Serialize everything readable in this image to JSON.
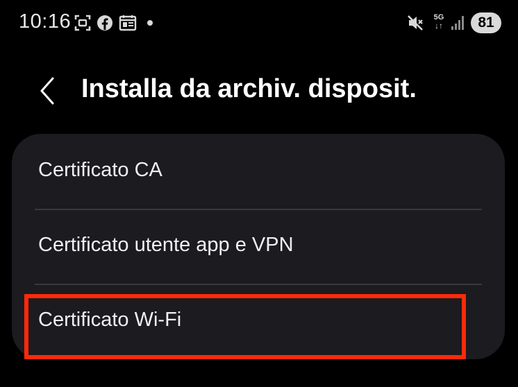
{
  "status_bar": {
    "time": "10:16",
    "network_type": "5G",
    "battery_level": "81",
    "icons": [
      "screenshot-icon",
      "facebook-icon",
      "calendar-news-icon",
      "notification-dot-icon",
      "mute-icon",
      "network-5g-icon",
      "signal-icon",
      "battery-icon"
    ]
  },
  "header": {
    "title": "Installa da archiv. disposit.",
    "back_icon": "chevron-left-icon"
  },
  "list": {
    "items": [
      {
        "label": "Certificato CA"
      },
      {
        "label": "Certificato utente app e VPN"
      },
      {
        "label": "Certificato Wi-Fi"
      }
    ]
  },
  "highlight": {
    "target": "Certificato Wi-Fi",
    "color": "#ff2a0a"
  },
  "colors": {
    "background": "#000000",
    "card": "#1c1b1f",
    "text": "#ffffff",
    "divider": "#3a3a3e"
  }
}
